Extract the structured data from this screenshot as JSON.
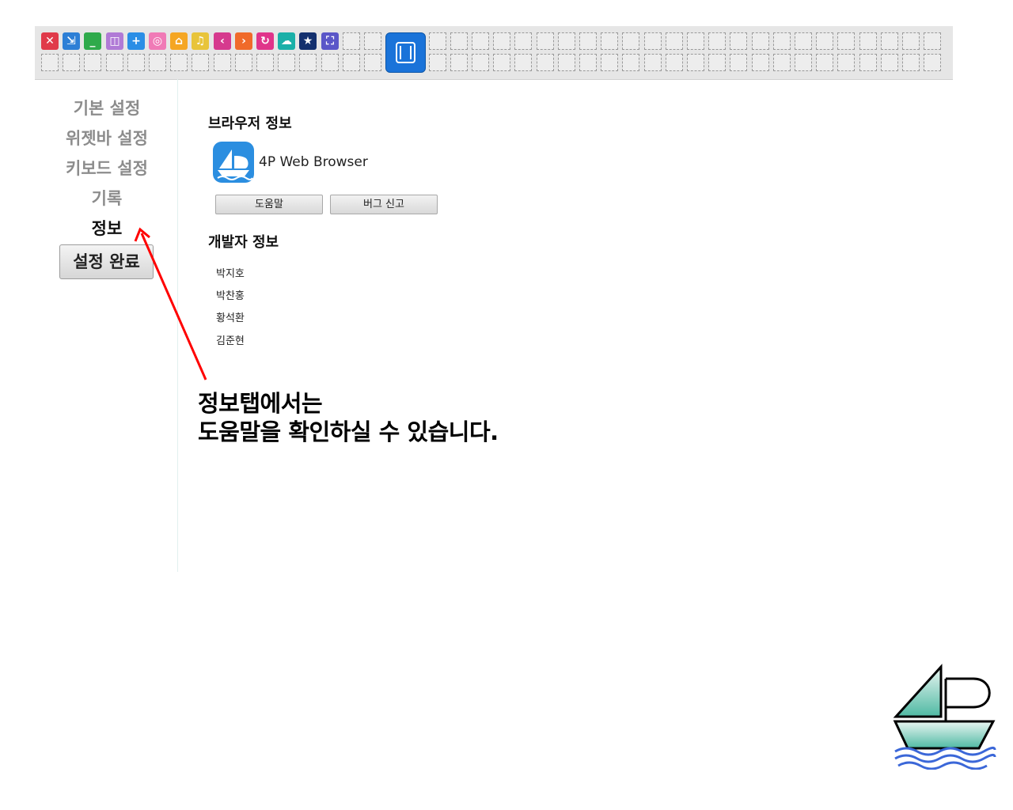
{
  "widget_bar": {
    "icons": [
      {
        "name": "close-icon",
        "glyph": "✕",
        "color": "#e03a4a"
      },
      {
        "name": "minimize-window-icon",
        "glyph": "⇲",
        "color": "#2d7fd6"
      },
      {
        "name": "minimize-icon",
        "glyph": "_",
        "color": "#2faa4b"
      },
      {
        "name": "split-window-icon",
        "glyph": "◫",
        "color": "#b07ad6"
      },
      {
        "name": "add-tab-icon",
        "glyph": "+",
        "color": "#2a8ee6"
      },
      {
        "name": "globe-icon",
        "glyph": "◎",
        "color": "#f07ab6"
      },
      {
        "name": "home-icon",
        "glyph": "⌂",
        "color": "#f5a623"
      },
      {
        "name": "music-icon",
        "glyph": "♫",
        "color": "#e8c43a"
      },
      {
        "name": "back-icon",
        "glyph": "‹",
        "color": "#d63a8e"
      },
      {
        "name": "forward-icon",
        "glyph": "›",
        "color": "#f06a2a"
      },
      {
        "name": "refresh-icon",
        "glyph": "↻",
        "color": "#e0348a"
      },
      {
        "name": "weather-icon",
        "glyph": "☁",
        "color": "#1ab0a8"
      },
      {
        "name": "bookmark-icon",
        "glyph": "★",
        "color": "#13306e"
      },
      {
        "name": "fullscreen-icon",
        "glyph": "⛶",
        "color": "#5a56c8"
      }
    ],
    "colors": {
      "big_widget": "#1a73d9"
    }
  },
  "sidebar": {
    "items": [
      {
        "label": "기본 설정"
      },
      {
        "label": "위젯바 설정"
      },
      {
        "label": "키보드 설정"
      },
      {
        "label": "기록"
      },
      {
        "label": "정보"
      }
    ],
    "done_label": "설정 완료"
  },
  "main": {
    "browser_info_title": "브라우저 정보",
    "app_name": "4P Web Browser",
    "help_button": "도움말",
    "bug_report_button": "버그 신고",
    "developer_info_title": "개발자 정보",
    "developers": [
      "박지호",
      "박찬홍",
      "황석환",
      "김준현"
    ]
  },
  "annotation": {
    "line1": "정보탭에서는",
    "line2": "도움말을 확인하실 수 있습니다.",
    "arrow_color": "#ff0000"
  }
}
